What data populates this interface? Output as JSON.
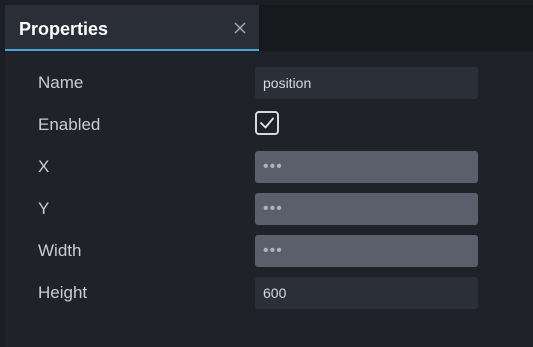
{
  "tab": {
    "title": "Properties",
    "close_icon": "close-icon"
  },
  "properties": [
    {
      "label": "Name",
      "kind": "text",
      "value": "position"
    },
    {
      "label": "Enabled",
      "kind": "checkbox",
      "checked": true
    },
    {
      "label": "X",
      "kind": "masked",
      "value": "•••"
    },
    {
      "label": "Y",
      "kind": "masked",
      "value": "•••"
    },
    {
      "label": "Width",
      "kind": "masked",
      "value": "•••"
    },
    {
      "label": "Height",
      "kind": "text",
      "value": "600"
    }
  ],
  "colors": {
    "accent": "#4aa3d9",
    "background": "#1f2329",
    "tab_background": "#2a2f37",
    "field_background": "#2b3038",
    "masked_field_background": "#5a606b"
  }
}
